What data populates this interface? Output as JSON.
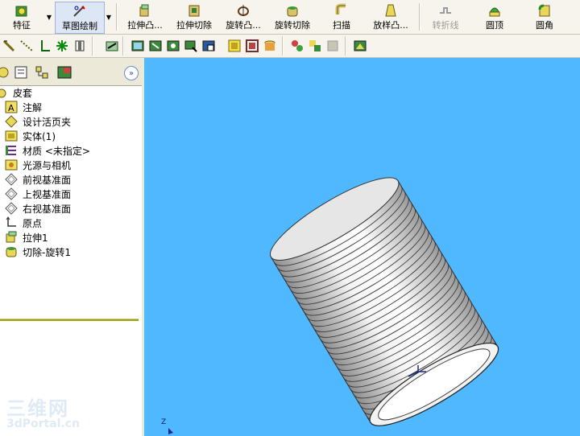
{
  "toolbar": {
    "tabs": [
      {
        "label": "特征",
        "icon": "feature-icon"
      },
      {
        "label": "草图绘制",
        "icon": "sketch-icon"
      }
    ],
    "commands": [
      {
        "label": "拉伸凸...",
        "icon": "extrude-boss-icon"
      },
      {
        "label": "拉伸切除",
        "icon": "extrude-cut-icon"
      },
      {
        "label": "旋转凸...",
        "icon": "revolve-boss-icon"
      },
      {
        "label": "旋转切除",
        "icon": "revolve-cut-icon"
      },
      {
        "label": "扫描",
        "icon": "sweep-icon"
      },
      {
        "label": "放样凸...",
        "icon": "loft-icon"
      },
      {
        "label": "转折线",
        "icon": "jog-line-icon",
        "disabled": true
      },
      {
        "label": "圆顶",
        "icon": "dome-icon"
      },
      {
        "label": "圆角",
        "icon": "fillet-icon"
      }
    ]
  },
  "tree": {
    "root": "皮套",
    "items": [
      {
        "label": "注解",
        "icon": "annotations-icon"
      },
      {
        "label": "设计活页夹",
        "icon": "design-binder-icon"
      },
      {
        "label": "实体(1)",
        "icon": "solid-bodies-icon"
      },
      {
        "label": "材质 <未指定>",
        "icon": "material-icon"
      },
      {
        "label": "光源与相机",
        "icon": "lights-cameras-icon"
      },
      {
        "label": "前视基准面",
        "icon": "plane-icon"
      },
      {
        "label": "上视基准面",
        "icon": "plane-icon"
      },
      {
        "label": "右视基准面",
        "icon": "plane-icon"
      },
      {
        "label": "原点",
        "icon": "origin-icon"
      },
      {
        "label": "拉伸1",
        "icon": "extrude-feature-icon"
      },
      {
        "label": "切除-旋转1",
        "icon": "revolve-cut-feature-icon"
      }
    ]
  },
  "viewport": {
    "background": "#4fb8ff",
    "axis_label": "Z"
  },
  "watermark": {
    "line1": "三维网",
    "line2": "3dPortal.cn"
  }
}
